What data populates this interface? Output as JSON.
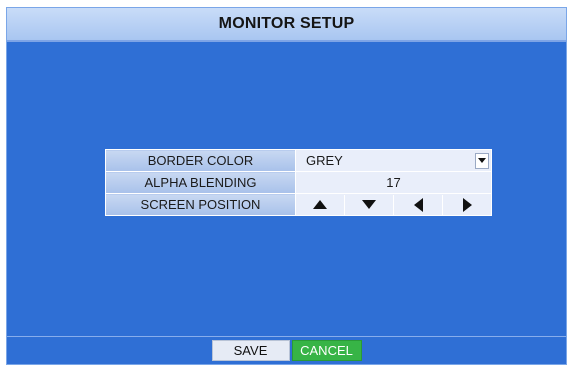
{
  "window": {
    "title": "MONITOR SETUP"
  },
  "settings": {
    "border_color": {
      "label": "BORDER COLOR",
      "value": "GREY"
    },
    "alpha_blending": {
      "label": "ALPHA BLENDING",
      "value": "17"
    },
    "screen_position": {
      "label": "SCREEN POSITION",
      "buttons": [
        "up",
        "down",
        "left",
        "right"
      ]
    }
  },
  "footer": {
    "save_label": "SAVE",
    "cancel_label": "CANCEL"
  },
  "colors": {
    "background": "#2f6fd5",
    "title_bar": "#b9d1f4",
    "cancel_button": "#37b446"
  }
}
